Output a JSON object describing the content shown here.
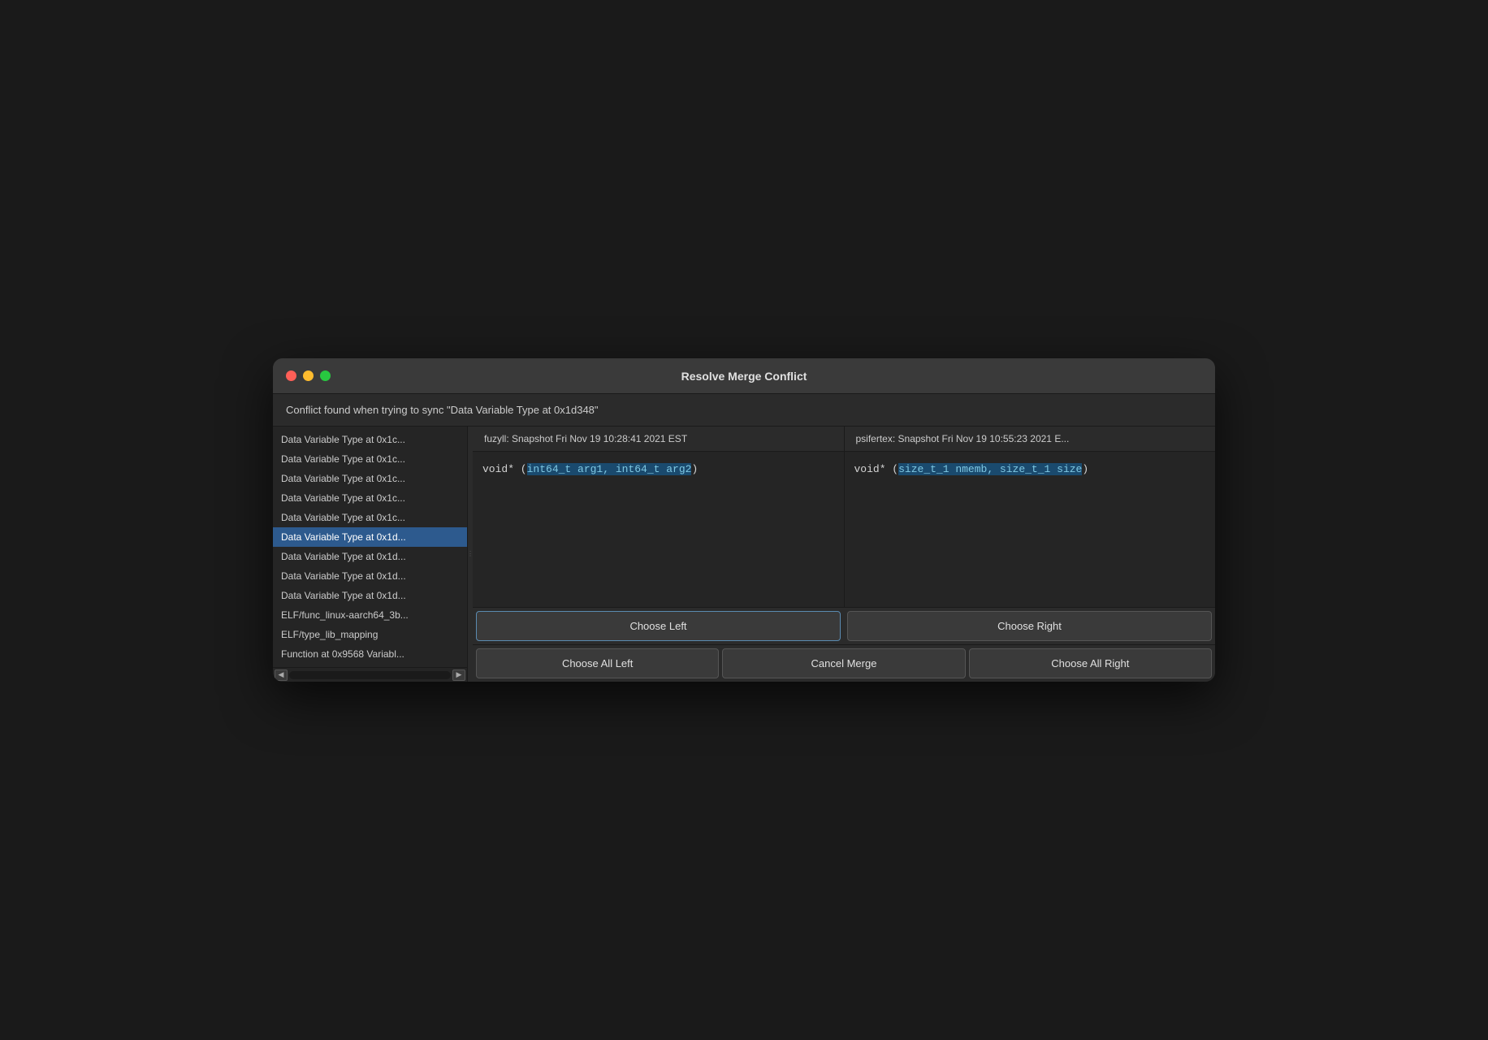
{
  "window": {
    "title": "Resolve Merge Conflict"
  },
  "banner": {
    "text": "Conflict found when trying to sync \"Data Variable Type at 0x1d348\""
  },
  "left_panel": {
    "items": [
      {
        "label": "Data Variable Type at 0x1c...",
        "selected": false
      },
      {
        "label": "Data Variable Type at 0x1c...",
        "selected": false
      },
      {
        "label": "Data Variable Type at 0x1c...",
        "selected": false
      },
      {
        "label": "Data Variable Type at 0x1c...",
        "selected": false
      },
      {
        "label": "Data Variable Type at 0x1c...",
        "selected": false
      },
      {
        "label": "Data Variable Type at 0x1d...",
        "selected": true
      },
      {
        "label": "Data Variable Type at 0x1d...",
        "selected": false
      },
      {
        "label": "Data Variable Type at 0x1d...",
        "selected": false
      },
      {
        "label": "Data Variable Type at 0x1d...",
        "selected": false
      },
      {
        "label": "ELF/func_linux-aarch64_3b...",
        "selected": false
      },
      {
        "label": "ELF/type_lib_mapping",
        "selected": false
      },
      {
        "label": "Function at 0x9568 Variabl...",
        "selected": false
      }
    ]
  },
  "left_diff": {
    "header": "fuzyll: Snapshot Fri Nov 19 10:28:41 2021 EST",
    "code_prefix": "void* (",
    "code_args": "int64_t arg1, int64_t arg2",
    "code_suffix": ")"
  },
  "right_diff": {
    "header": "psifertex: Snapshot Fri Nov 19 10:55:23 2021 E...",
    "code_prefix": "void* (",
    "code_args": "size_t_1 nmemb, size_t_1 size",
    "code_suffix": ")"
  },
  "buttons": {
    "choose_left": "Choose Left",
    "choose_right": "Choose Right",
    "choose_all_left": "Choose All Left",
    "cancel_merge": "Cancel Merge",
    "choose_all_right": "Choose All Right"
  }
}
